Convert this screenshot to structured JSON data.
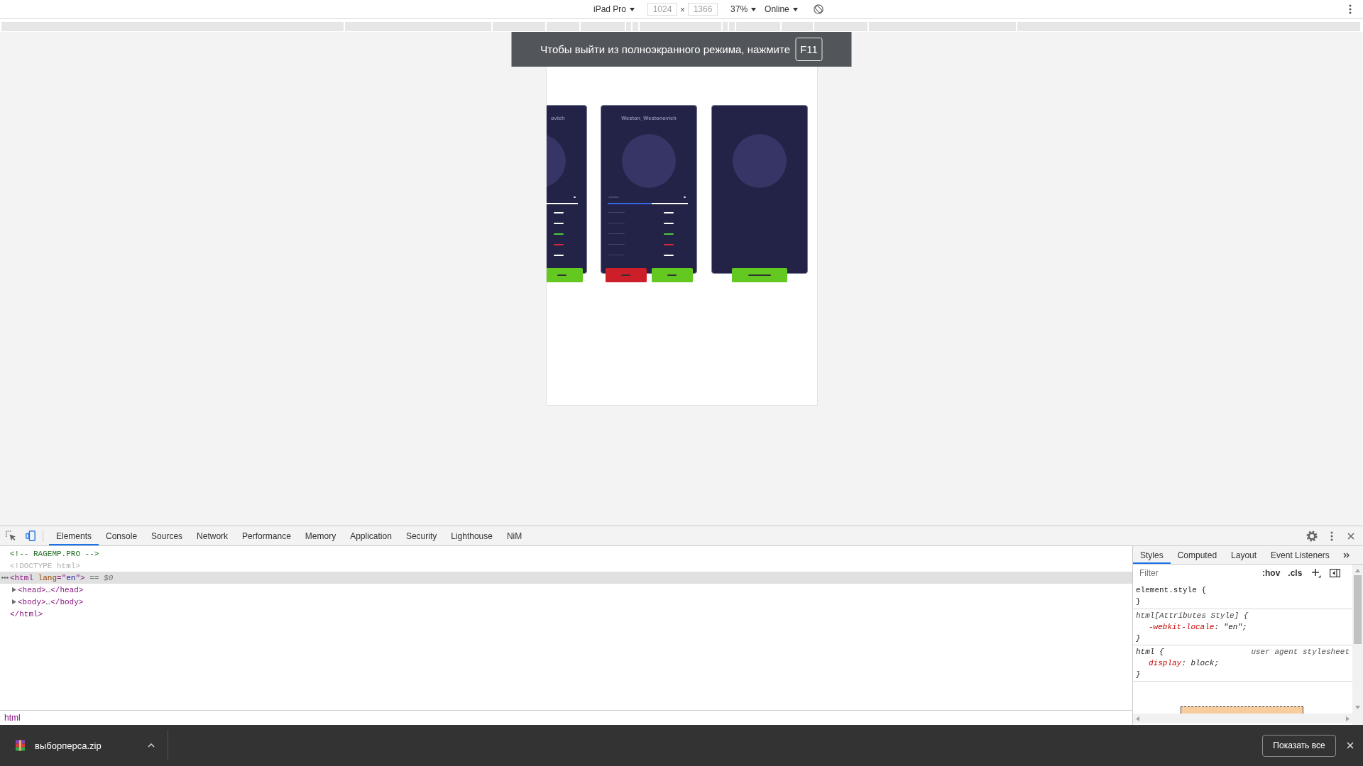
{
  "toolbar": {
    "device": "iPad Pro",
    "width": {
      "value": "1024",
      "disabled": true
    },
    "times": "×",
    "height": {
      "value": "1366",
      "disabled": true
    },
    "zoom": "37%",
    "throttling": "Online"
  },
  "fullscreen_notice": {
    "text": "Чтобы выйти из полноэкранного режима, нажмите",
    "key": "F11"
  },
  "viewport": {
    "cards": [
      {
        "kind": "cut",
        "title": "ovich",
        "stats": [
          {
            "color": "#ffffff"
          },
          {
            "color": "#ffffff"
          },
          {
            "color": "#4fc93a"
          },
          {
            "color": "#d8263c"
          },
          {
            "color": "#ffffff"
          }
        ],
        "buttons": [
          {
            "kind": "narrow",
            "color": "#63c81f"
          }
        ]
      },
      {
        "kind": "full",
        "title": "Weston_Westonovich",
        "level": 0.55,
        "stats": [
          {
            "color": "#ffffff"
          },
          {
            "color": "#ffffff"
          },
          {
            "color": "#4fc93a"
          },
          {
            "color": "#d8263c"
          },
          {
            "color": "#ffffff"
          }
        ],
        "buttons": [
          {
            "kind": "narrow",
            "color": "#cc1f29"
          },
          {
            "kind": "narrow",
            "color": "#63c81f"
          }
        ]
      },
      {
        "kind": "full",
        "buttons": [
          {
            "kind": "wide",
            "color": "#63c81f"
          }
        ]
      }
    ]
  },
  "devtools": {
    "tabs": [
      {
        "label": "Elements",
        "selected": true
      },
      {
        "label": "Console",
        "selected": false
      },
      {
        "label": "Sources",
        "selected": false
      },
      {
        "label": "Network",
        "selected": false
      },
      {
        "label": "Performance",
        "selected": false
      },
      {
        "label": "Memory",
        "selected": false
      },
      {
        "label": "Application",
        "selected": false
      },
      {
        "label": "Security",
        "selected": false
      },
      {
        "label": "Lighthouse",
        "selected": false
      },
      {
        "label": "NiM",
        "selected": false
      }
    ],
    "elements_tree": [
      {
        "selected": false,
        "parts": [
          {
            "kind": "comment",
            "text": "<!-- RAGEMP.PRO -->"
          }
        ]
      },
      {
        "selected": false,
        "parts": [
          {
            "kind": "doctype",
            "text": "<!DOCTYPE html>"
          }
        ]
      },
      {
        "selected": true,
        "parts": [
          {
            "kind": "tag",
            "text": "<html"
          },
          {
            "kind": "attr",
            "text": " lang"
          },
          {
            "kind": "tag",
            "text": "=\""
          },
          {
            "kind": "value",
            "text": "en"
          },
          {
            "kind": "tag",
            "text": "\">"
          },
          {
            "kind": "marker",
            "text": " == $0"
          }
        ],
        "children": [
          {
            "selected": false,
            "expanded": false,
            "parts": [
              {
                "kind": "tag",
                "text": "<head>"
              },
              {
                "kind": "text",
                "text": "…"
              },
              {
                "kind": "tag",
                "text": "</head>"
              }
            ]
          },
          {
            "selected": false,
            "expanded": false,
            "parts": [
              {
                "kind": "tag",
                "text": "<body>"
              },
              {
                "kind": "text",
                "text": "…"
              },
              {
                "kind": "tag",
                "text": "</body>"
              }
            ]
          }
        ],
        "closing": [
          {
            "kind": "tag",
            "text": "</html>"
          }
        ]
      }
    ],
    "breadcrumb": "html",
    "styles_tabs": [
      {
        "label": "Styles",
        "selected": true
      },
      {
        "label": "Computed",
        "selected": false
      },
      {
        "label": "Layout",
        "selected": false
      },
      {
        "label": "Event Listeners",
        "selected": false
      }
    ],
    "filter": {
      "placeholder": "Filter"
    },
    "style_toggles": [
      ":hov",
      ".cls"
    ],
    "rules": [
      {
        "kind": "inline",
        "selector": "element.style {",
        "close": "}"
      },
      {
        "kind": "attributes",
        "selector": "html[Attributes Style] {",
        "declarations": [
          {
            "property": "-webkit-locale",
            "value": ": \"en\";"
          }
        ],
        "close": "}"
      },
      {
        "kind": "user_agent",
        "selector": "html {",
        "source": "user agent stylesheet",
        "declarations": [
          {
            "property": "display",
            "value": ": block;"
          }
        ],
        "close": "}"
      }
    ]
  },
  "download_bar": {
    "file_name": "выборперса.zip",
    "show_all": "Показать все"
  }
}
